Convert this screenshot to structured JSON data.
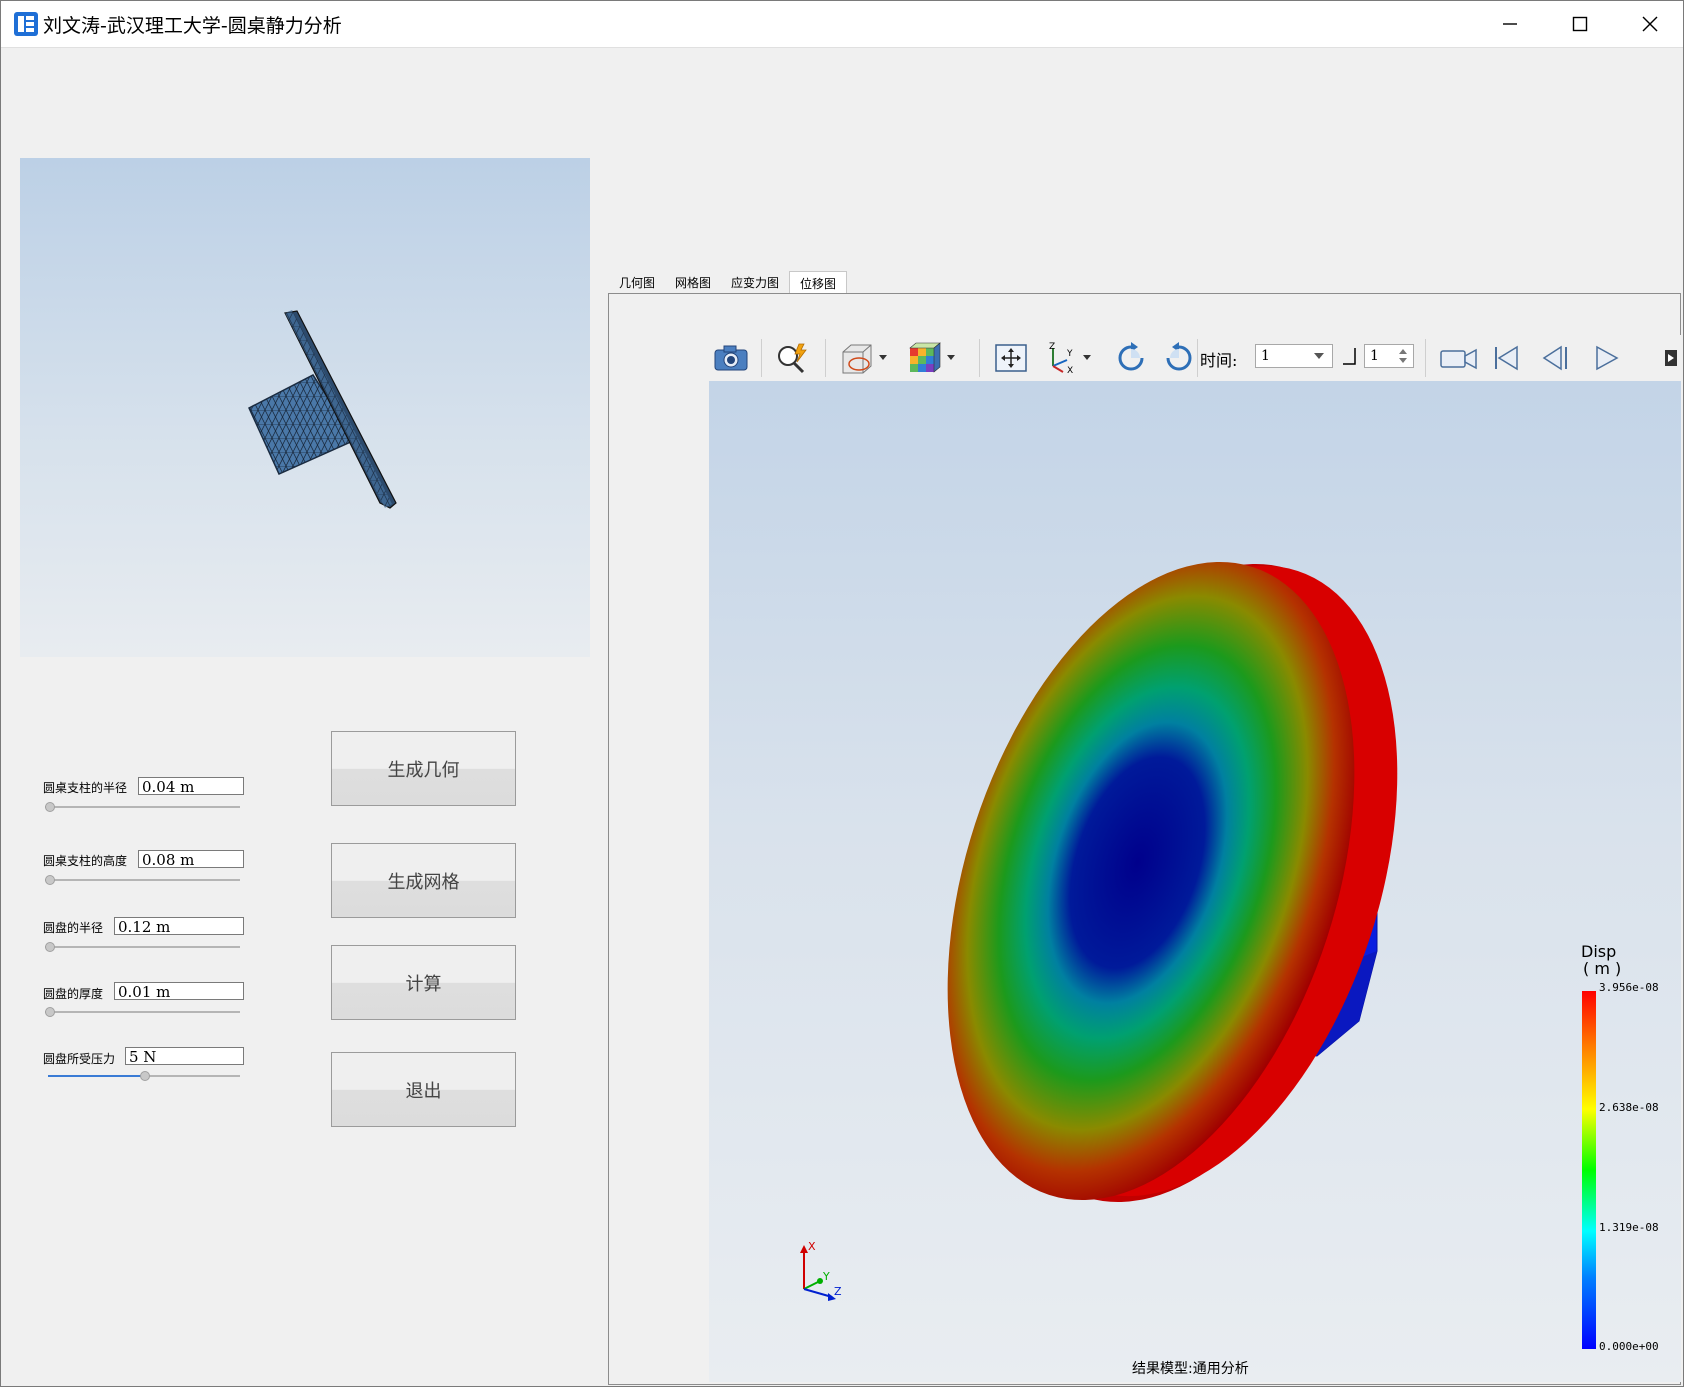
{
  "window": {
    "title": "刘文涛-武汉理工大学-圆桌静力分析",
    "controls": [
      "minimize-icon",
      "maximize-icon",
      "close-icon"
    ]
  },
  "params": [
    {
      "label": "圆桌支柱的半径",
      "value": "0.04 m",
      "slider_fraction": 0.0
    },
    {
      "label": "圆桌支柱的高度",
      "value": "0.08 m",
      "slider_fraction": 0.0
    },
    {
      "label": "圆盘的半径",
      "value": "0.12 m",
      "slider_fraction": 0.0
    },
    {
      "label": "圆盘的厚度",
      "value": "0.01 m",
      "slider_fraction": 0.0
    },
    {
      "label": "圆盘所受压力",
      "value": "5 N",
      "slider_fraction": 0.5
    }
  ],
  "buttons": {
    "generate_geometry": "生成几何",
    "generate_mesh": "生成网格",
    "compute": "计算",
    "exit": "退出"
  },
  "tabs": [
    {
      "label": "几何图",
      "active": false
    },
    {
      "label": "网格图",
      "active": false
    },
    {
      "label": "应变力图",
      "active": false
    },
    {
      "label": "位移图",
      "active": true
    }
  ],
  "toolbar": {
    "icons": [
      "camera-icon",
      "query-icon",
      "clip-box-icon",
      "color-cube-icon",
      "fit-view-icon",
      "axes-orient-icon",
      "rotate-cw-icon",
      "rotate-ccw-icon",
      "record-video-icon",
      "first-frame-icon",
      "prev-frame-icon",
      "play-icon"
    ],
    "time_label": "时间:",
    "time_value": "1",
    "step_value": "1"
  },
  "legend": {
    "title": "Disp",
    "unit": "( m )",
    "ticks": [
      "3.956e-08",
      "2.638e-08",
      "1.319e-08",
      "0.000e+00"
    ],
    "colors": {
      "max": "#ff0000",
      "mid_high": "#ffff00",
      "mid": "#00ff00",
      "mid_low": "#00ffff",
      "min": "#0000ff"
    }
  },
  "triad": {
    "x": "X",
    "y": "Y",
    "z": "Z"
  },
  "footer": {
    "model_label": "结果模型:通用分析"
  },
  "colors": {
    "accent": "#3a7bd5",
    "mesh_blue": "#3f6fa0"
  }
}
